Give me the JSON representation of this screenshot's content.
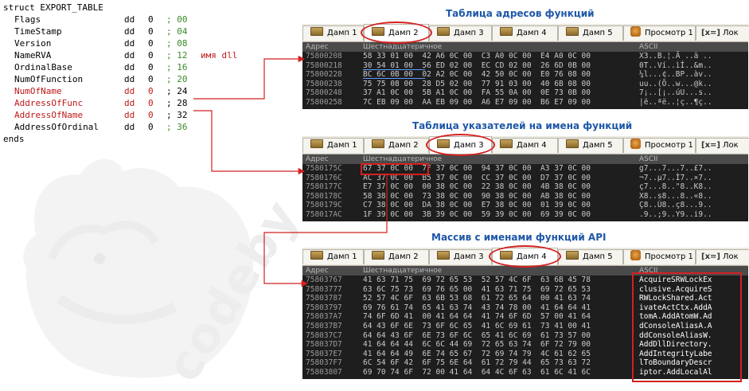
{
  "struct": {
    "header": "struct EXPORT_TABLE",
    "fields": [
      {
        "name": "Flags",
        "dd": "dd",
        "val": "0",
        "comment": "; 00",
        "highlight": false,
        "comment_green": true,
        "note": ""
      },
      {
        "name": "TimeStamp",
        "dd": "dd",
        "val": "0",
        "comment": "; 04",
        "highlight": false,
        "comment_green": true,
        "note": ""
      },
      {
        "name": "Version",
        "dd": "dd",
        "val": "0",
        "comment": "; 08",
        "highlight": false,
        "comment_green": true,
        "note": ""
      },
      {
        "name": "NameRVA",
        "dd": "dd",
        "val": "0",
        "comment": "; 12",
        "highlight": false,
        "comment_green": true,
        "note": "имя dll"
      },
      {
        "name": "OrdinalBase",
        "dd": "dd",
        "val": "0",
        "comment": "; 16",
        "highlight": false,
        "comment_green": true,
        "note": ""
      },
      {
        "name": "NumOfFunction",
        "dd": "dd",
        "val": "0",
        "comment": "; 20",
        "highlight": false,
        "comment_green": true,
        "note": ""
      },
      {
        "name": "NumOfName",
        "dd": "dd",
        "val": "0",
        "comment": "; 24",
        "highlight": true,
        "comment_green": false,
        "note": ""
      },
      {
        "name": "AddressOfFunc",
        "dd": "dd",
        "val": "0",
        "comment": "; 28",
        "highlight": true,
        "comment_green": false,
        "note": ""
      },
      {
        "name": "AddressOfName",
        "dd": "dd",
        "val": "0",
        "comment": "; 32",
        "highlight": true,
        "comment_green": false,
        "note": ""
      },
      {
        "name": "AddressOfOrdinal",
        "dd": "dd",
        "val": "0",
        "comment": "; 36",
        "highlight": false,
        "comment_green": true,
        "note": ""
      }
    ],
    "footer": "ends"
  },
  "watermark": "codeby",
  "colors": {
    "accent_red": "#d42020",
    "caption_blue": "#1e57a8",
    "comment_green": "#3a8a2a",
    "dump_bg": "#1e1e1e"
  },
  "tab_labels": [
    "Дамп 1",
    "Дамп 2",
    "Дамп 3",
    "Дамп 4",
    "Дамп 5",
    "Просмотр 1",
    "Лок"
  ],
  "tab_icons": {
    "dump": "dump-icon",
    "watch": "owl-icon",
    "locals": "x-equals-icon"
  },
  "tab_locals_prefix": "[x=]",
  "columns": {
    "address": "Адрес",
    "hex": "Шестнадцатеричное",
    "ascii": "ASCII"
  },
  "panels": [
    {
      "caption": "Таблица адресов функций",
      "active_tab": 1,
      "rows": [
        {
          "addr": "75800208",
          "hex": "58 33 01 00  42 A6 0C 00  C3 A0 0C 00  E4 A0 0C 00",
          "ascii": "X3..B.¦.Ã ..ä .."
        },
        {
          "addr": "75800218",
          "hex": "30 54 01 00  56 ED 02 00  EC CD 02 00  26 6D 0B 00",
          "ascii": "0T..Ví..ìÍ..&m.."
        },
        {
          "addr": "75800228",
          "hex": "BC 6C 0B 00  02 A2 0C 00  42 50 0C 00  E0 76 08 00",
          "ascii": "¼l...¢..BP..àv.."
        },
        {
          "addr": "75800238",
          "hex": "75 75 08 00  28 D5 02 00  77 91 03 00  40 6B 08 00",
          "ascii": "uu..(Õ..w...@k.."
        },
        {
          "addr": "75800248",
          "hex": "37 A1 0C 00  5B A1 0C 00  FA 55 0A 00  0E 73 0B 00",
          "ascii": "7¡..[¡..úU...s.."
        },
        {
          "addr": "75800258",
          "hex": "7C EB 09 00  AA EB 09 00  A6 E7 09 00  B6 E7 09 00",
          "ascii": "|ë..ªë..¦ç..¶ç.."
        }
      ]
    },
    {
      "caption": "Таблица указателей на имена функций",
      "active_tab": 2,
      "rows": [
        {
          "addr": "7580175C",
          "hex": "67 37 0C 00  7F 37 0C 00  94 37 0C 00  A3 37 0C 00",
          "ascii": "g7...7...7..£7.."
        },
        {
          "addr": "7580176C",
          "hex": "AC 37 0C 00  B5 37 0C 00  CC 37 0C 00  D7 37 0C 00",
          "ascii": "¬7..µ7..Ì7..×7.."
        },
        {
          "addr": "7580177C",
          "hex": "E7 37 0C 00  00 38 0C 00  22 38 0C 00  4B 38 0C 00",
          "ascii": "ç7...8..\"8..K8.."
        },
        {
          "addr": "7580178C",
          "hex": "58 38 0C 00  73 38 0C 00  90 38 0C 00  AB 38 0C 00",
          "ascii": "X8..s8...8..«8.."
        },
        {
          "addr": "7580179C",
          "hex": "C7 38 0C 00  DA 38 0C 00  E7 38 0C 00  01 39 0C 00",
          "ascii": "Ç8..Ú8..ç8...9.."
        },
        {
          "addr": "758017AC",
          "hex": "1F 39 0C 00  3B 39 0C 00  59 39 0C 00  69 39 0C 00",
          "ascii": ".9..;9..Y9..i9.."
        }
      ]
    },
    {
      "caption": "Массив с именами функций API",
      "active_tab": 3,
      "rows": [
        {
          "addr": "75803767",
          "hex": "41 63 71 75  69 72 65 53  52 57 4C 6F  63 6B 45 78",
          "ascii": "AcquireSRWLockEx"
        },
        {
          "addr": "75803777",
          "hex": "63 6C 75 73  69 76 65 00  41 63 71 75  69 72 65 53",
          "ascii": "clusive.AcquireS"
        },
        {
          "addr": "75803787",
          "hex": "52 57 4C 6F  63 6B 53 68  61 72 65 64  00 41 63 74",
          "ascii": "RWLockShared.Act"
        },
        {
          "addr": "75803797",
          "hex": "69 76 61 74  65 41 63 74  43 74 78 00  41 64 64 41",
          "ascii": "ivateActCtx.AddA"
        },
        {
          "addr": "758037A7",
          "hex": "74 6F 6D 41  00 41 64 64  41 74 6F 6D  57 00 41 64",
          "ascii": "tomA.AddAtomW.Ad"
        },
        {
          "addr": "758037B7",
          "hex": "64 43 6F 6E  73 6F 6C 65  41 6C 69 61  73 41 00 41",
          "ascii": "dConsoleAliasA.A"
        },
        {
          "addr": "758037C7",
          "hex": "64 64 43 6F  6E 73 6F 6C  65 41 6C 69  61 73 57 00",
          "ascii": "ddConsoleAliasW."
        },
        {
          "addr": "758037D7",
          "hex": "41 64 64 44  6C 6C 44 69  72 65 63 74  6F 72 79 00",
          "ascii": "AddDllDirectory."
        },
        {
          "addr": "758037E7",
          "hex": "41 64 64 49  6E 74 65 67  72 69 74 79  4C 61 62 65",
          "ascii": "AddIntegrityLabe"
        },
        {
          "addr": "758037F7",
          "hex": "6C 54 6F 42  6F 75 6E 64  61 72 79 44  65 73 63 72",
          "ascii": "lToBoundaryDescr"
        },
        {
          "addr": "75803807",
          "hex": "69 70 74 6F  72 00 41 64  64 4C 6F 63  61 6C 41 6C",
          "ascii": "iptor.AddLocalAl"
        }
      ]
    }
  ]
}
